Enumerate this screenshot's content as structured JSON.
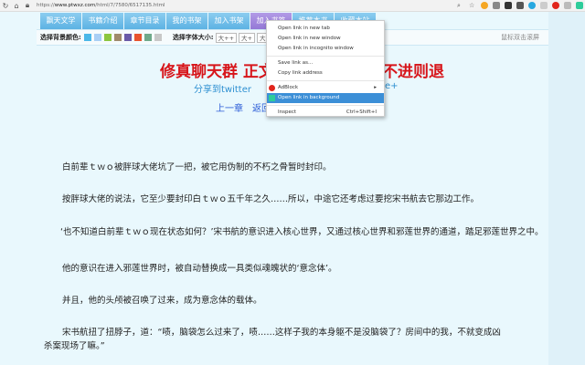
{
  "browser": {
    "url_prefix": "https://",
    "url_host": "www.ptwxz.com",
    "url_path": "/html/7/7580/6517135.html"
  },
  "nav": [
    {
      "label": "飘天文学"
    },
    {
      "label": "书籍介绍"
    },
    {
      "label": "章节目录"
    },
    {
      "label": "我的书架"
    },
    {
      "label": "加入书架"
    },
    {
      "label": "加入书签"
    },
    {
      "label": "推荐本书"
    },
    {
      "label": "收藏本站"
    }
  ],
  "toolbar": {
    "bg_label": "选择背景颜色:",
    "font_label": "选择字体大小:",
    "font_sizes": [
      "大++",
      "大+",
      "大"
    ],
    "dblclick": "鼠标双击滚屏",
    "swatches": [
      "#4bb8e8",
      "#a9cff5",
      "#8cc63f",
      "#a08a6c",
      "#6a5aa8",
      "#e8542e",
      "#6fa98a",
      "#c8c8c8"
    ]
  },
  "chapter": {
    "title_left": "修真聊天群 正文 第",
    "title_right": "不进则退",
    "share_twitter": "分享到twitter",
    "share_google": "e+",
    "prev": "上一章",
    "back": "返回"
  },
  "paragraphs": [
    "白前辈ｔｗｏ被胖球大佬坑了一把，被它用伪制的不朽之骨暂时封印。",
    "按胖球大佬的说法，它至少要封印白ｔｗｏ五千年之久……所以，中途它还考虑过要挖宋书航去它那边工作。",
    "‘也不知道白前辈ｔｗｏ现在状态如何？’宋书航的意识进入核心世界，又通过核心世界和邪莲世界的通道，踏足邪莲世界之中。",
    "他的意识在进入邪莲世界时，被自动替换成一具类似魂魄状的‘意念体’。",
    "并且，他的头颅被召唤了过来，成为意念体的载体。",
    "宋书航扭了扭脖子，道：“啧，脑袋怎么过来了，啧……这样子我的本身躯不是没脑袋了？房间中的我，不就变成凶杀案现场了嘛。”"
  ],
  "context_menu": {
    "items": [
      "Open link in new tab",
      "Open link in new window",
      "Open link in incognito window",
      "Save link as...",
      "Copy link address",
      "AdBlock",
      "Open link in background",
      "Inspect"
    ],
    "inspect_shortcut": "Ctrl+Shift+I"
  },
  "colors": {
    "accent": "#3c8fd7",
    "title": "#d7151a"
  }
}
